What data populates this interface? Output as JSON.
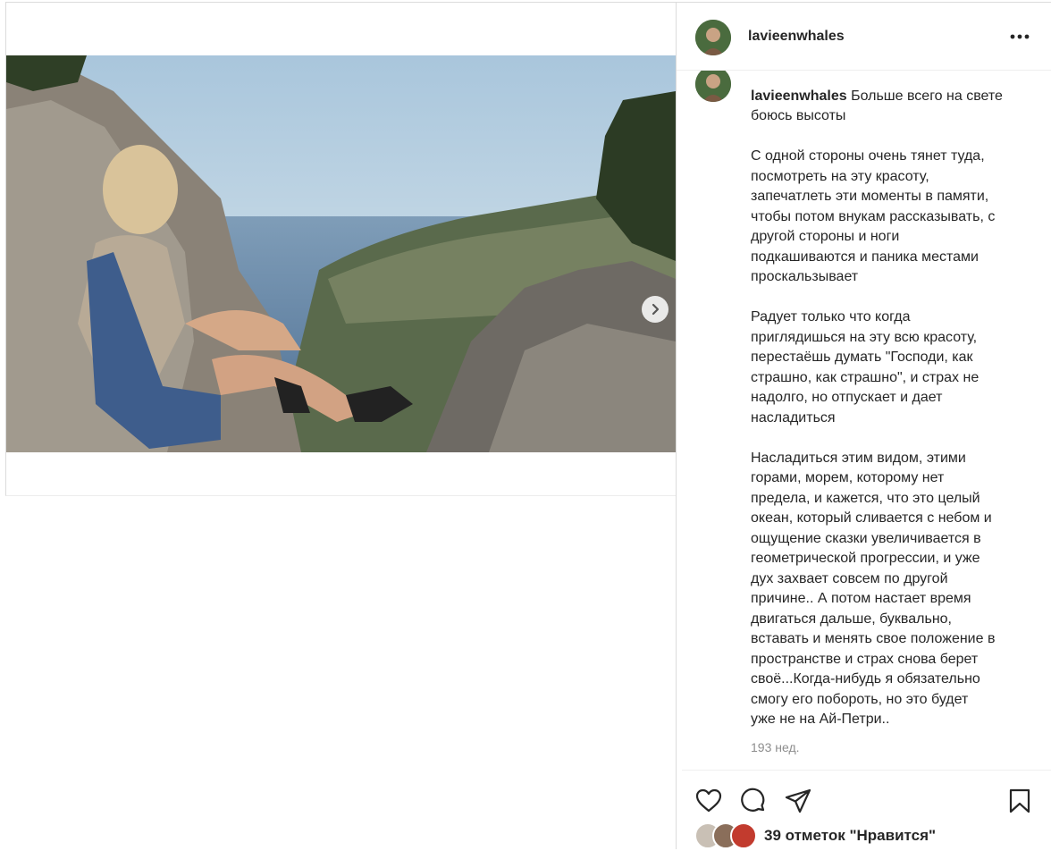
{
  "post": {
    "username": "lavieenwhales",
    "caption_lines": [
      "Больше всего на свете\nбоюсь высоты",
      "",
      "С одной стороны очень тянет туда,\nпосмотреть на эту красоту,\nзапечатлеть эти моменты в памяти,\nчтобы потом внукам рассказывать, с\nдругой стороны и ноги\nподкашиваются и паника местами\nпроскальзывает",
      "",
      "Радует только что когда\nприглядишься на эту всю красоту,\nперестаёшь думать \"Господи, как\nстрашно, как страшно\", и страх не\nнадолго, но отпускает и дает\nнасладиться",
      "",
      "Насладиться этим видом, этими\nгорами, морем, которому нет\nпредела, и кажется, что это целый\nокеан, который сливается с небом и\nощущение сказки увеличивается в\nгеометрической прогрессии, и уже\nдух захвает совсем по другой\nпричине.. А потом настает время\nдвигаться дальше, буквально,\nвставать и менять свое положение в\nпространстве и страх снова берет\nсвоё...Когда-нибудь я обязательно\nсмогу его побороть, но это будет\nуже не на Ай-Петри.."
    ],
    "time_ago": "193 нед.",
    "likes_text": "39 отметок \"Нравится\""
  },
  "carousel": {
    "slide_count": 3,
    "active_index": 0
  },
  "icons": {
    "more": "more-horizontal-icon",
    "next": "chevron-right-icon",
    "like": "heart-icon",
    "comment": "comment-icon",
    "share": "share-icon",
    "save": "bookmark-icon"
  },
  "colors": {
    "border": "#dbdbdb",
    "text": "#262626",
    "muted": "#8e8e8e"
  }
}
